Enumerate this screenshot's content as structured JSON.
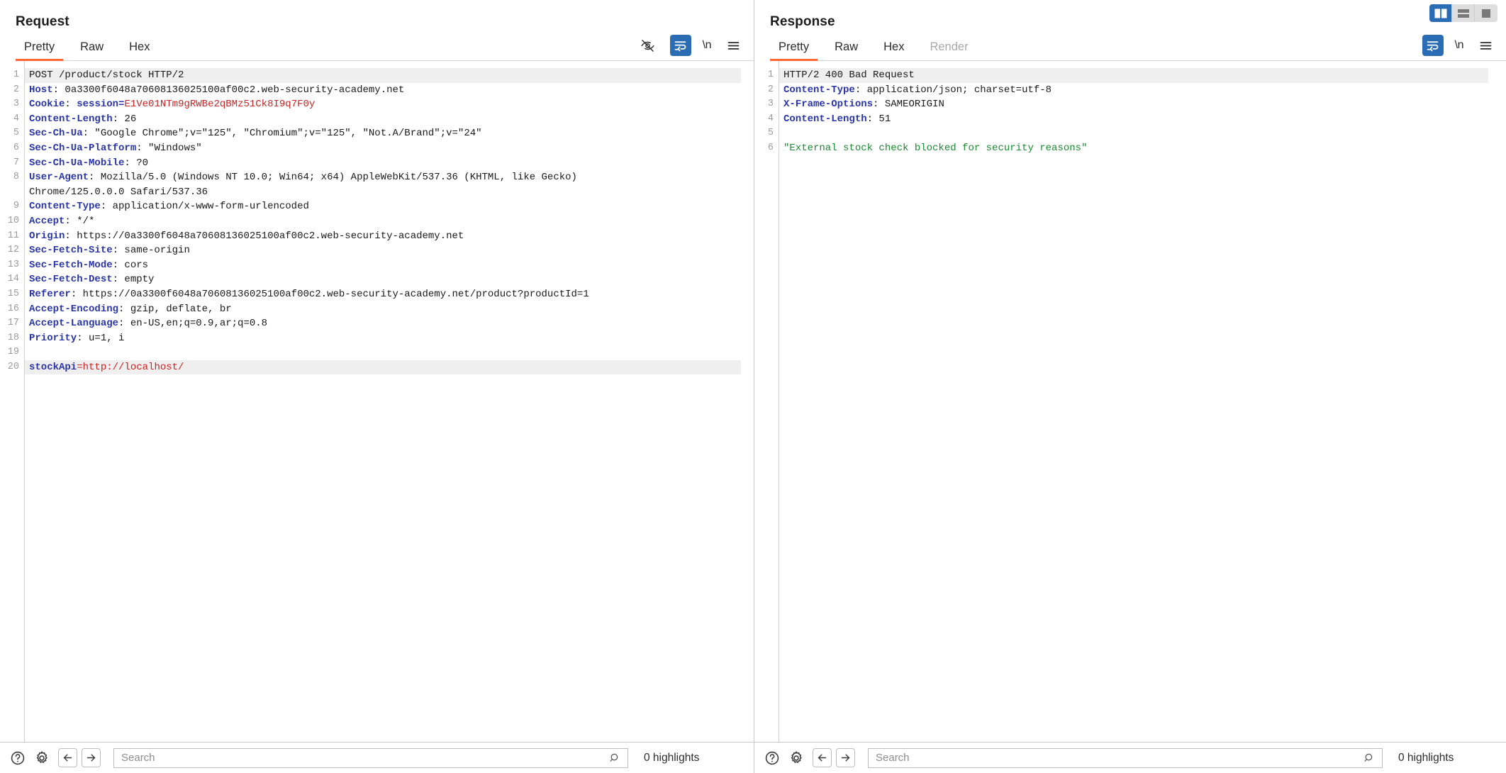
{
  "layout_toggle": {
    "options": [
      {
        "name": "vertical-split",
        "selected": true
      },
      {
        "name": "horizontal-split",
        "selected": false
      },
      {
        "name": "single-pane",
        "selected": false
      }
    ]
  },
  "request": {
    "title": "Request",
    "tabs": [
      {
        "label": "Pretty",
        "active": true,
        "disabled": false
      },
      {
        "label": "Raw",
        "active": false,
        "disabled": false
      },
      {
        "label": "Hex",
        "active": false,
        "disabled": false
      }
    ],
    "actions": [
      {
        "name": "hide-eye-icon",
        "kind": "eye-slash"
      },
      {
        "name": "word-wrap-icon",
        "kind": "wrap",
        "active": true
      },
      {
        "name": "show-newlines-label",
        "kind": "text",
        "label": "\\n"
      },
      {
        "name": "menu-icon",
        "kind": "hamburger"
      }
    ],
    "lines": [
      {
        "n": "1",
        "hl": true,
        "tall": false,
        "segs": [
          {
            "t": "POST /product/stock HTTP/2",
            "c": "b"
          }
        ]
      },
      {
        "n": "2",
        "hl": false,
        "tall": false,
        "segs": [
          {
            "t": "Host",
            "c": "k"
          },
          {
            "t": ": ",
            "c": "v"
          },
          {
            "t": "0a3300f6048a70608136025100af00c2.web-security-academy.net",
            "c": "v"
          }
        ]
      },
      {
        "n": "3",
        "hl": false,
        "tall": false,
        "segs": [
          {
            "t": "Cookie",
            "c": "k"
          },
          {
            "t": ": ",
            "c": "v"
          },
          {
            "t": "session=",
            "c": "k"
          },
          {
            "t": "E1Ve01NTm9gRWBe2qBMz51Ck8I9q7F0y",
            "c": "red"
          }
        ]
      },
      {
        "n": "4",
        "hl": false,
        "tall": false,
        "segs": [
          {
            "t": "Content-Length",
            "c": "k"
          },
          {
            "t": ": 26",
            "c": "v"
          }
        ]
      },
      {
        "n": "5",
        "hl": false,
        "tall": false,
        "segs": [
          {
            "t": "Sec-Ch-Ua",
            "c": "k"
          },
          {
            "t": ": \"Google Chrome\";v=\"125\", \"Chromium\";v=\"125\", \"Not.A/Brand\";v=\"24\"",
            "c": "v"
          }
        ]
      },
      {
        "n": "6",
        "hl": false,
        "tall": false,
        "segs": [
          {
            "t": "Sec-Ch-Ua-Platform",
            "c": "k"
          },
          {
            "t": ": \"Windows\"",
            "c": "v"
          }
        ]
      },
      {
        "n": "7",
        "hl": false,
        "tall": false,
        "segs": [
          {
            "t": "Sec-Ch-Ua-Mobile",
            "c": "k"
          },
          {
            "t": ": ?0",
            "c": "v"
          }
        ]
      },
      {
        "n": "8",
        "hl": false,
        "tall": true,
        "segs": [
          {
            "t": "User-Agent",
            "c": "k"
          },
          {
            "t": ": Mozilla/5.0 (Windows NT 10.0; Win64; x64) AppleWebKit/537.36 (KHTML, like Gecko)\nChrome/125.0.0.0 Safari/537.36",
            "c": "v"
          }
        ]
      },
      {
        "n": "9",
        "hl": false,
        "tall": false,
        "segs": [
          {
            "t": "Content-Type",
            "c": "k"
          },
          {
            "t": ": application/x-www-form-urlencoded",
            "c": "v"
          }
        ]
      },
      {
        "n": "10",
        "hl": false,
        "tall": false,
        "segs": [
          {
            "t": "Accept",
            "c": "k"
          },
          {
            "t": ": */*",
            "c": "v"
          }
        ]
      },
      {
        "n": "11",
        "hl": false,
        "tall": false,
        "segs": [
          {
            "t": "Origin",
            "c": "k"
          },
          {
            "t": ": https://0a3300f6048a70608136025100af00c2.web-security-academy.net",
            "c": "v"
          }
        ]
      },
      {
        "n": "12",
        "hl": false,
        "tall": false,
        "segs": [
          {
            "t": "Sec-Fetch-Site",
            "c": "k"
          },
          {
            "t": ": same-origin",
            "c": "v"
          }
        ]
      },
      {
        "n": "13",
        "hl": false,
        "tall": false,
        "segs": [
          {
            "t": "Sec-Fetch-Mode",
            "c": "k"
          },
          {
            "t": ": cors",
            "c": "v"
          }
        ]
      },
      {
        "n": "14",
        "hl": false,
        "tall": false,
        "segs": [
          {
            "t": "Sec-Fetch-Dest",
            "c": "k"
          },
          {
            "t": ": empty",
            "c": "v"
          }
        ]
      },
      {
        "n": "15",
        "hl": false,
        "tall": false,
        "segs": [
          {
            "t": "Referer",
            "c": "k"
          },
          {
            "t": ": https://0a3300f6048a70608136025100af00c2.web-security-academy.net/product?productId=1",
            "c": "v"
          }
        ]
      },
      {
        "n": "16",
        "hl": false,
        "tall": false,
        "segs": [
          {
            "t": "Accept-Encoding",
            "c": "k"
          },
          {
            "t": ": gzip, deflate, br",
            "c": "v"
          }
        ]
      },
      {
        "n": "17",
        "hl": false,
        "tall": false,
        "segs": [
          {
            "t": "Accept-Language",
            "c": "k"
          },
          {
            "t": ": en-US,en;q=0.9,ar;q=0.8",
            "c": "v"
          }
        ]
      },
      {
        "n": "18",
        "hl": false,
        "tall": false,
        "segs": [
          {
            "t": "Priority",
            "c": "k"
          },
          {
            "t": ": u=1, i",
            "c": "v"
          }
        ]
      },
      {
        "n": "19",
        "hl": false,
        "tall": false,
        "segs": [
          {
            "t": "",
            "c": "v"
          }
        ]
      },
      {
        "n": "20",
        "hl": true,
        "tall": false,
        "segs": [
          {
            "t": "stockApi",
            "c": "prm"
          },
          {
            "t": "=",
            "c": "red"
          },
          {
            "t": "http://localhost/",
            "c": "red"
          }
        ]
      }
    ],
    "bottom": {
      "help_icon": "help-icon",
      "settings_icon": "gear-icon",
      "back_icon": "arrow-left-icon",
      "forward_icon": "arrow-right-icon",
      "search_placeholder": "Search",
      "search_value": "",
      "highlights": "0 highlights"
    }
  },
  "response": {
    "title": "Response",
    "tabs": [
      {
        "label": "Pretty",
        "active": true,
        "disabled": false
      },
      {
        "label": "Raw",
        "active": false,
        "disabled": false
      },
      {
        "label": "Hex",
        "active": false,
        "disabled": false
      },
      {
        "label": "Render",
        "active": false,
        "disabled": true
      }
    ],
    "actions": [
      {
        "name": "word-wrap-icon",
        "kind": "wrap",
        "active": true
      },
      {
        "name": "show-newlines-label",
        "kind": "text",
        "label": "\\n"
      },
      {
        "name": "menu-icon",
        "kind": "hamburger"
      }
    ],
    "lines": [
      {
        "n": "1",
        "hl": true,
        "tall": false,
        "segs": [
          {
            "t": "HTTP/2 400 Bad Request",
            "c": "b"
          }
        ]
      },
      {
        "n": "2",
        "hl": false,
        "tall": false,
        "segs": [
          {
            "t": "Content-Type",
            "c": "k"
          },
          {
            "t": ": application/json; charset=utf-8",
            "c": "v"
          }
        ]
      },
      {
        "n": "3",
        "hl": false,
        "tall": false,
        "segs": [
          {
            "t": "X-Frame-Options",
            "c": "k"
          },
          {
            "t": ": SAMEORIGIN",
            "c": "v"
          }
        ]
      },
      {
        "n": "4",
        "hl": false,
        "tall": false,
        "segs": [
          {
            "t": "Content-Length",
            "c": "k"
          },
          {
            "t": ": 51",
            "c": "v"
          }
        ]
      },
      {
        "n": "5",
        "hl": false,
        "tall": false,
        "segs": [
          {
            "t": "",
            "c": "v"
          }
        ]
      },
      {
        "n": "6",
        "hl": false,
        "tall": false,
        "segs": [
          {
            "t": "\"External stock check blocked for security reasons\"",
            "c": "grn"
          }
        ]
      }
    ],
    "bottom": {
      "help_icon": "help-icon",
      "settings_icon": "gear-icon",
      "back_icon": "arrow-left-icon",
      "forward_icon": "arrow-right-icon",
      "search_placeholder": "Search",
      "search_value": "",
      "highlights": "0 highlights"
    }
  },
  "colors": {
    "accent_orange": "#ff6633",
    "accent_blue": "#2a6db5",
    "header_name": "#2934a8",
    "cookie_value": "#cc2222",
    "json_body": "#1a8b31",
    "line_highlight": "#efefef"
  }
}
